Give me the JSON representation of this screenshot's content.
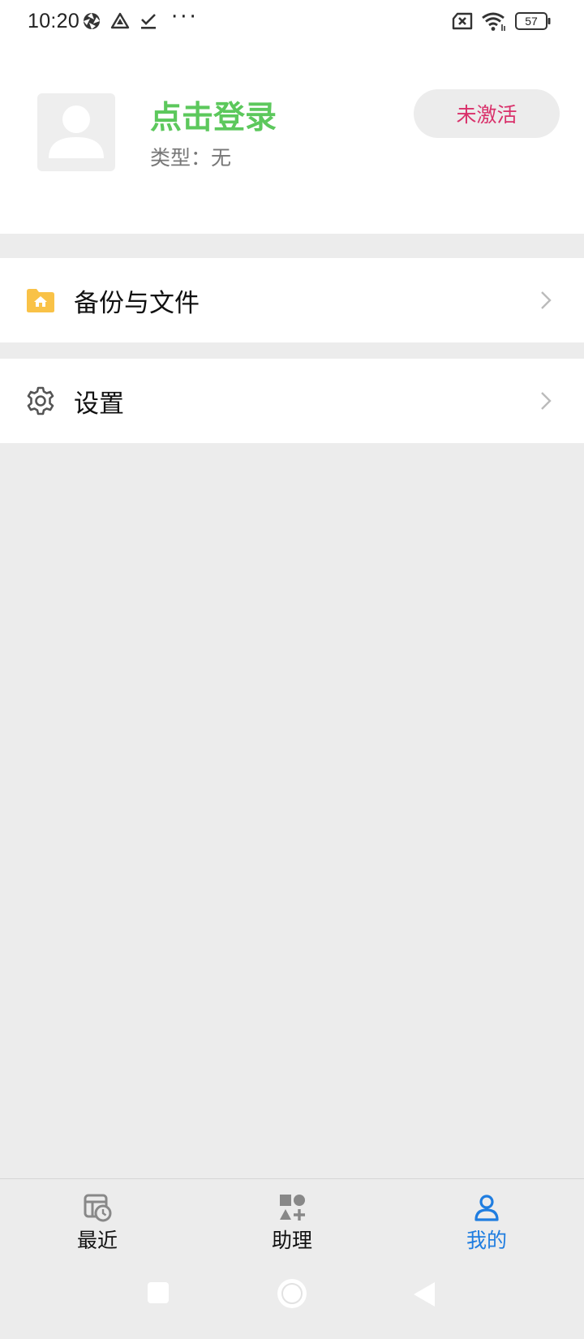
{
  "status_bar": {
    "time": "10:20",
    "more": "···",
    "battery_level": "57"
  },
  "profile": {
    "login_label": "点击登录",
    "type_label": "类型：无",
    "activate_label": "未激活"
  },
  "menu": {
    "items": [
      {
        "label": "备份与文件",
        "icon": "folder-home-icon"
      },
      {
        "label": "设置",
        "icon": "gear-icon"
      }
    ]
  },
  "bottom_nav": {
    "items": [
      {
        "label": "最近",
        "icon": "recent-icon",
        "active": false
      },
      {
        "label": "助理",
        "icon": "apps-shapes-icon",
        "active": false
      },
      {
        "label": "我的",
        "icon": "person-icon",
        "active": true
      }
    ]
  },
  "colors": {
    "login_green": "#5cc85c",
    "inactive_pink": "#d9306a",
    "active_blue": "#1f7de0",
    "folder_yellow": "#f9c247"
  }
}
